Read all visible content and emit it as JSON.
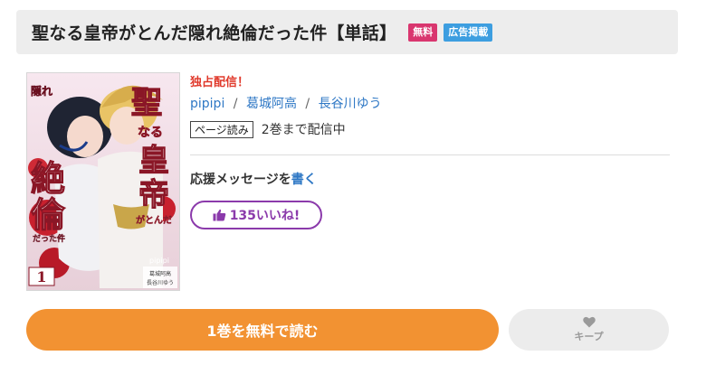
{
  "title_bar": {
    "title": "聖なる皇帝がとんだ隠れ絶倫だった件【単話】",
    "badges": [
      {
        "label": "無料",
        "color": "#d9366f"
      },
      {
        "label": "広告掲載",
        "color": "#3d9ee0"
      }
    ]
  },
  "cover": {
    "title_lines": [
      "聖",
      "なる",
      "皇",
      "帝",
      "がとんだ"
    ],
    "side_text": [
      "隠れ",
      "絶",
      "倫",
      "だった件"
    ],
    "volume": "1",
    "publisher": "pipipi",
    "credits": [
      "葛城阿高",
      "長谷川ゆう"
    ]
  },
  "info": {
    "exclusive": "独占配信！",
    "authors": [
      {
        "name": "pipipi"
      },
      {
        "name": "葛城阿高"
      },
      {
        "name": "長谷川ゆう"
      }
    ],
    "author_separator": "/",
    "read_tag": "ページ読み",
    "volume_status": "2巻まで配信中",
    "support_prefix": "応援メッセージを",
    "support_link": "書く",
    "like_label": "135いいね!"
  },
  "actions": {
    "read_label": "1巻を無料で読む",
    "keep_label": "キープ"
  },
  "colors": {
    "accent_orange": "#f29232",
    "exclusive_red": "#e0392b",
    "link_blue": "#2f78c5",
    "like_purple": "#8b3aab",
    "keep_gray": "#ececec",
    "keep_text": "#9a9a9a"
  },
  "icons": {
    "like": "thumbs-up-icon",
    "keep": "heart-icon"
  }
}
